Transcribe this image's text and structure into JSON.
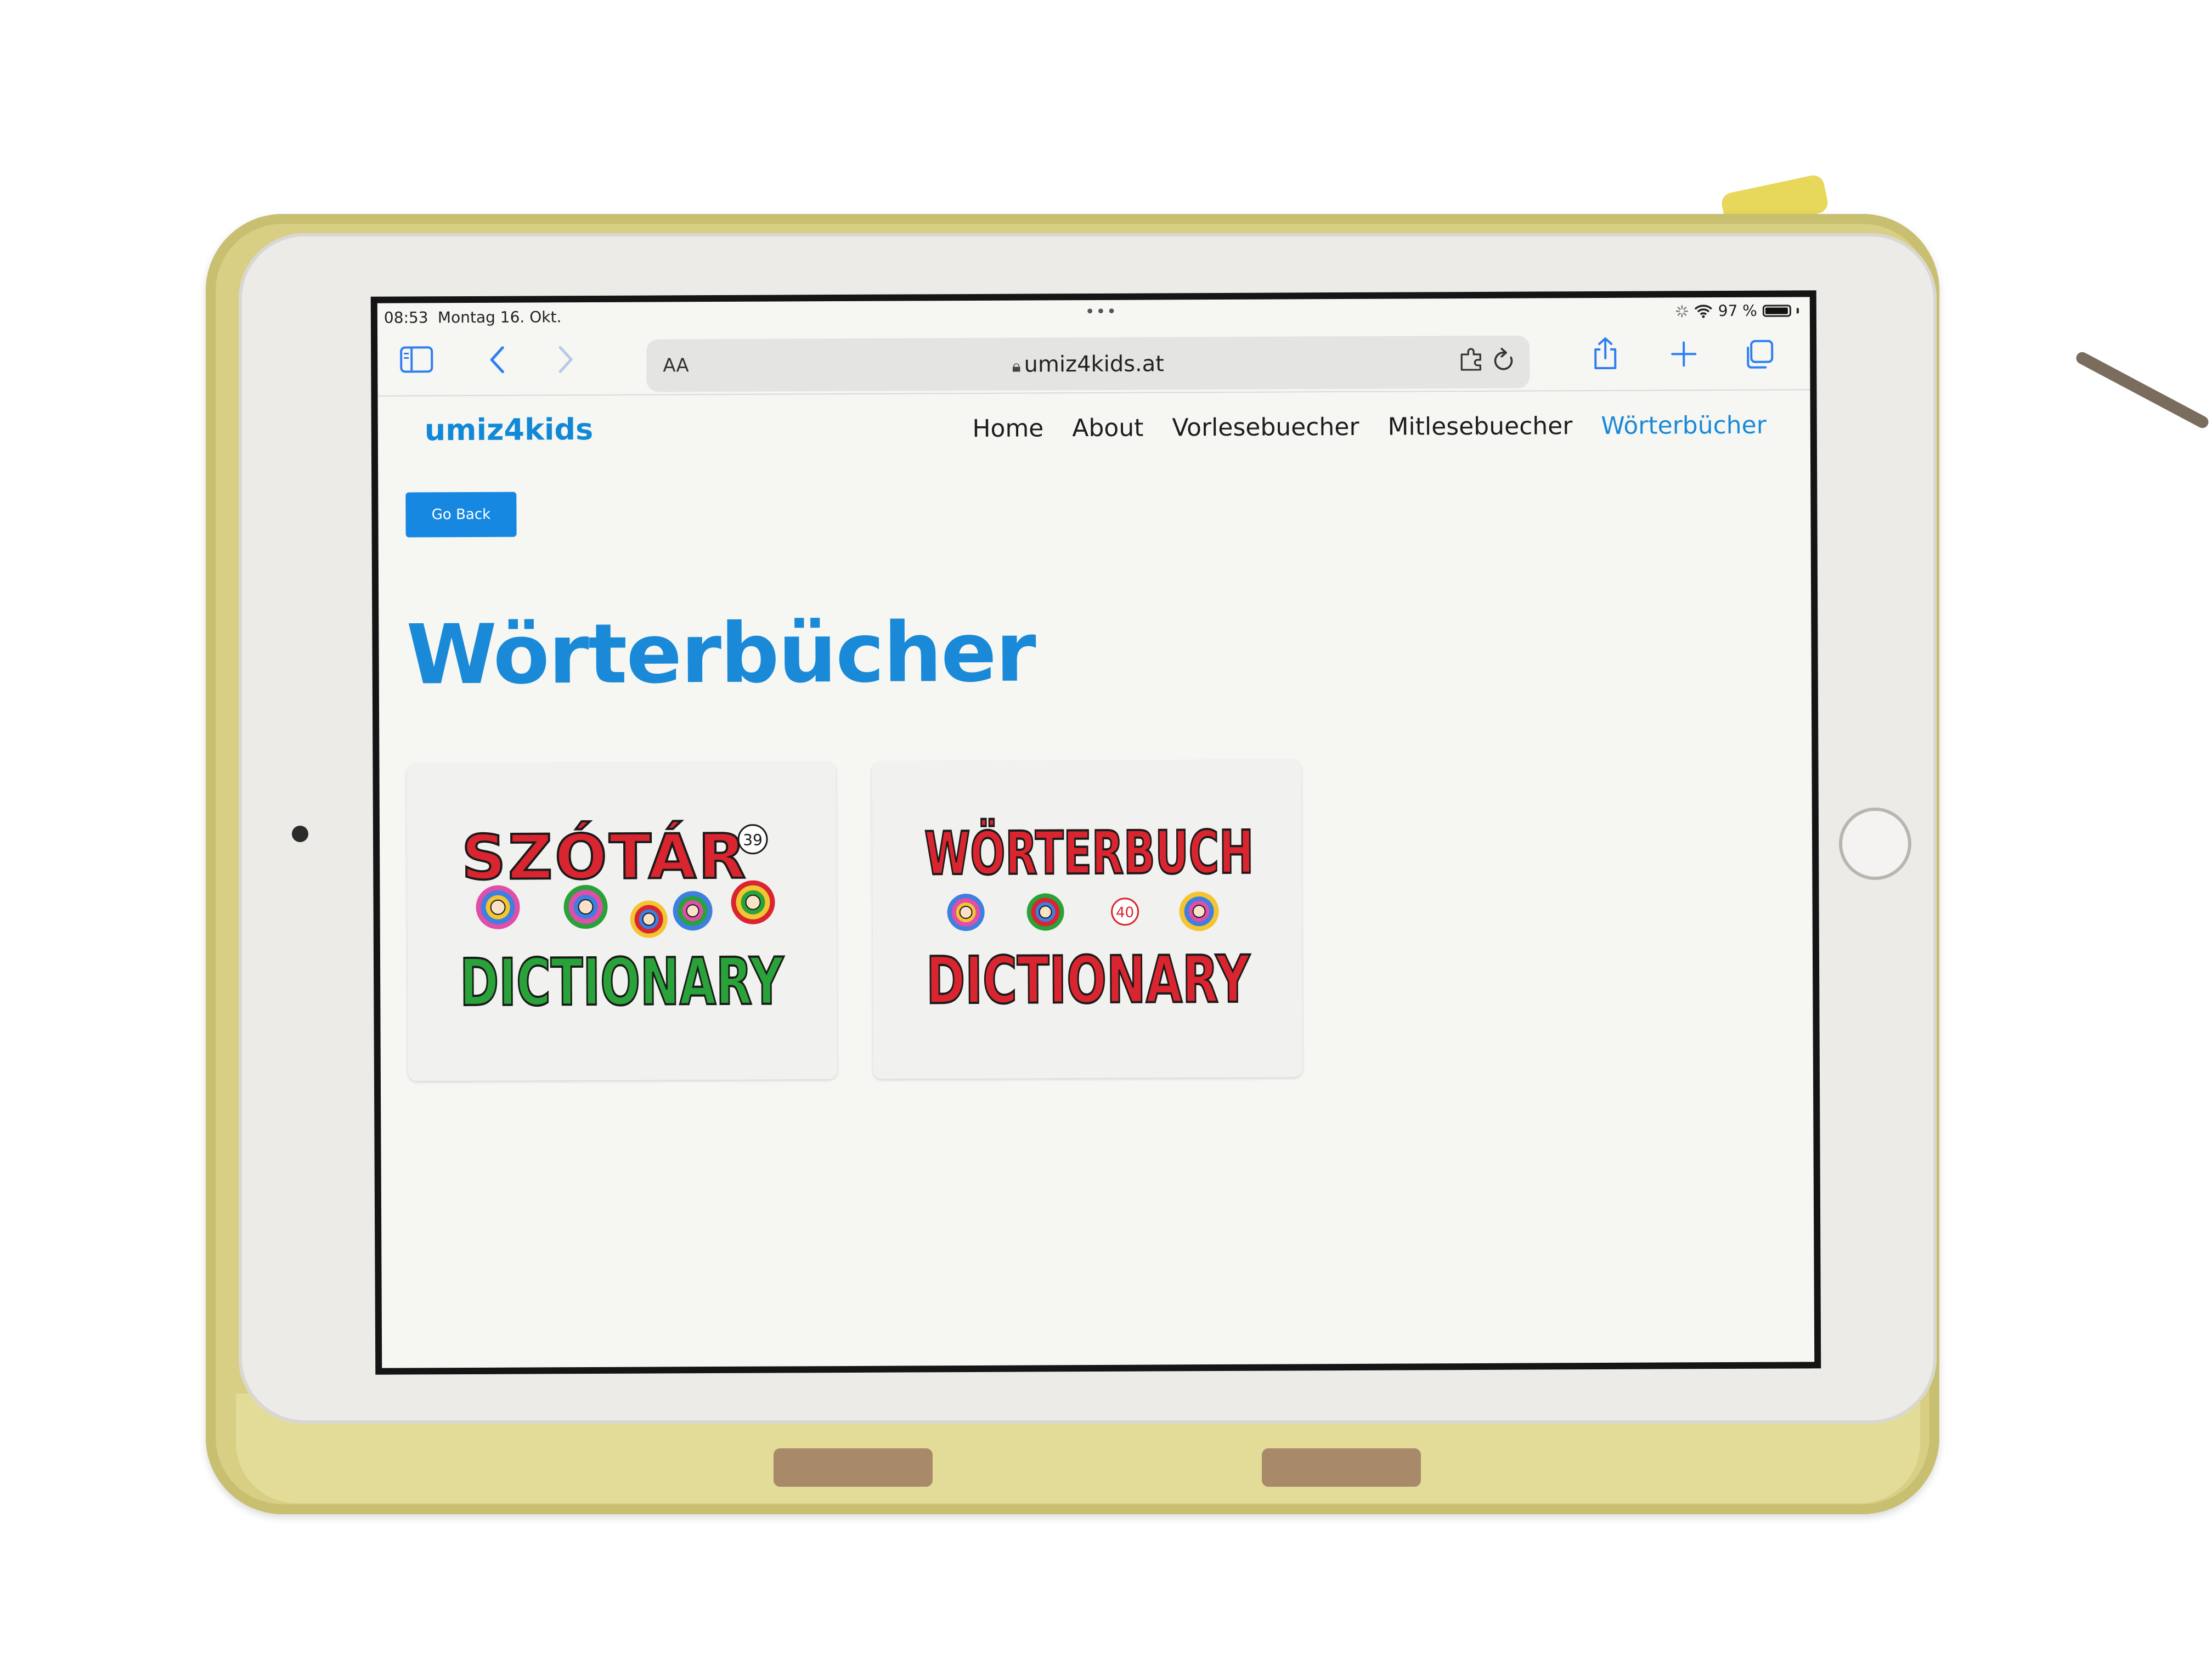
{
  "status_bar": {
    "time": "08:53",
    "date": "Montag 16. Okt.",
    "battery": "97 %",
    "battery_level": 0.97
  },
  "browser": {
    "reader_label": "AA",
    "url": "umiz4kids.at"
  },
  "site": {
    "logo": "umiz4kids",
    "nav": [
      {
        "label": "Home"
      },
      {
        "label": "About"
      },
      {
        "label": "Vorlesebuecher"
      },
      {
        "label": "Mitlesebuecher"
      },
      {
        "label": "Wörterbücher",
        "active": true
      }
    ],
    "go_back_label": "Go Back",
    "page_title": "Wörterbücher"
  },
  "books": [
    {
      "line1": "SZÓTÁR",
      "number": "39",
      "line2": "DICTIONARY"
    },
    {
      "line1": "WÖRTERBUCH",
      "number": "40",
      "line2": "DICTIONARY"
    }
  ],
  "colors": {
    "brand_blue": "#1a8ad8",
    "button_blue": "#1788e2",
    "safari_blue": "#2f7ff2",
    "letter_red": "#d9252f",
    "letter_green": "#2aa23a",
    "letter_gray": "#bdbdbd"
  },
  "icons": {
    "sidebar": "sidebar-icon",
    "back": "chevron-left-icon",
    "forward": "chevron-right-icon",
    "lock": "lock-icon",
    "extension": "puzzle-extension-icon",
    "reload": "reload-icon",
    "share": "share-icon",
    "new_tab": "plus-icon",
    "tabs": "tabs-overview-icon"
  }
}
